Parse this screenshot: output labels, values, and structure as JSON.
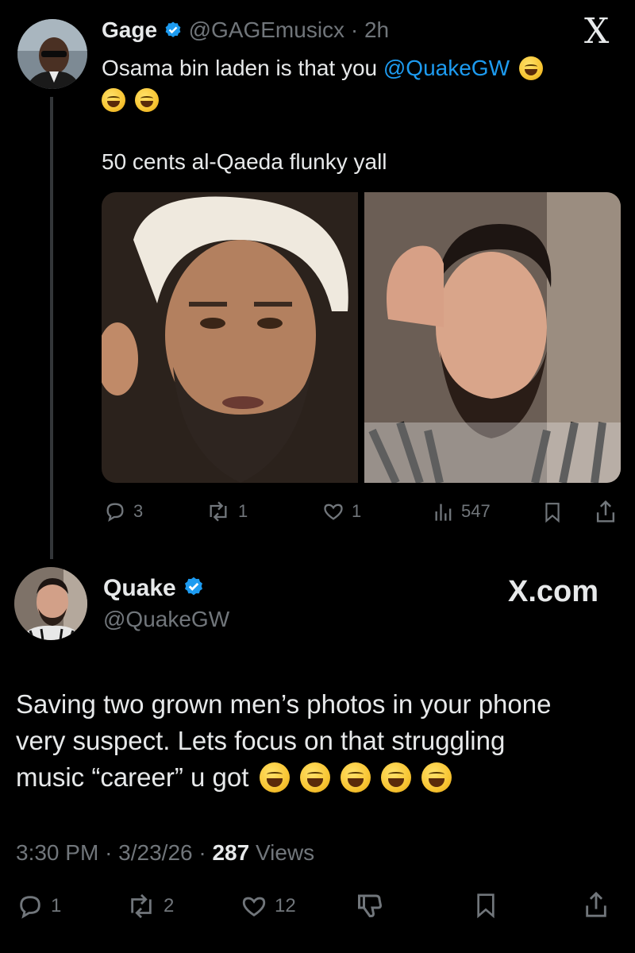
{
  "colors": {
    "background": "#000000",
    "text": "#e7e9ea",
    "muted": "#71767b",
    "link": "#1d9bf0",
    "verified": "#1d9bf0"
  },
  "top_tweet": {
    "display_name": "Gage",
    "handle": "@GAGEmusicx",
    "separator": "·",
    "time": "2h",
    "text_line1": "Osama bin laden is that you ",
    "mention": "@QuakeGW",
    "text_line3": "50 cents al-Qaeda flunky yall",
    "images": [
      {
        "alt": "photo-left",
        "icon": "portrait-photo"
      },
      {
        "alt": "photo-right",
        "icon": "portrait-photo"
      }
    ],
    "actions": {
      "replies": "3",
      "reposts": "1",
      "likes": "1",
      "views": "547"
    },
    "x_logo": "X"
  },
  "reply_tweet": {
    "display_name": "Quake",
    "handle": "@QuakeGW",
    "brand": "X.com",
    "text_line1": "Saving two grown men’s photos in your phone",
    "text_line2": "very suspect. Lets focus on that struggling",
    "text_line3": "music “career” u got ",
    "time": "3:30 PM",
    "separator": "·",
    "date": "3/23/26",
    "views_count": "287",
    "views_label": " Views",
    "actions": {
      "replies": "1",
      "reposts": "2",
      "likes": "12"
    }
  }
}
